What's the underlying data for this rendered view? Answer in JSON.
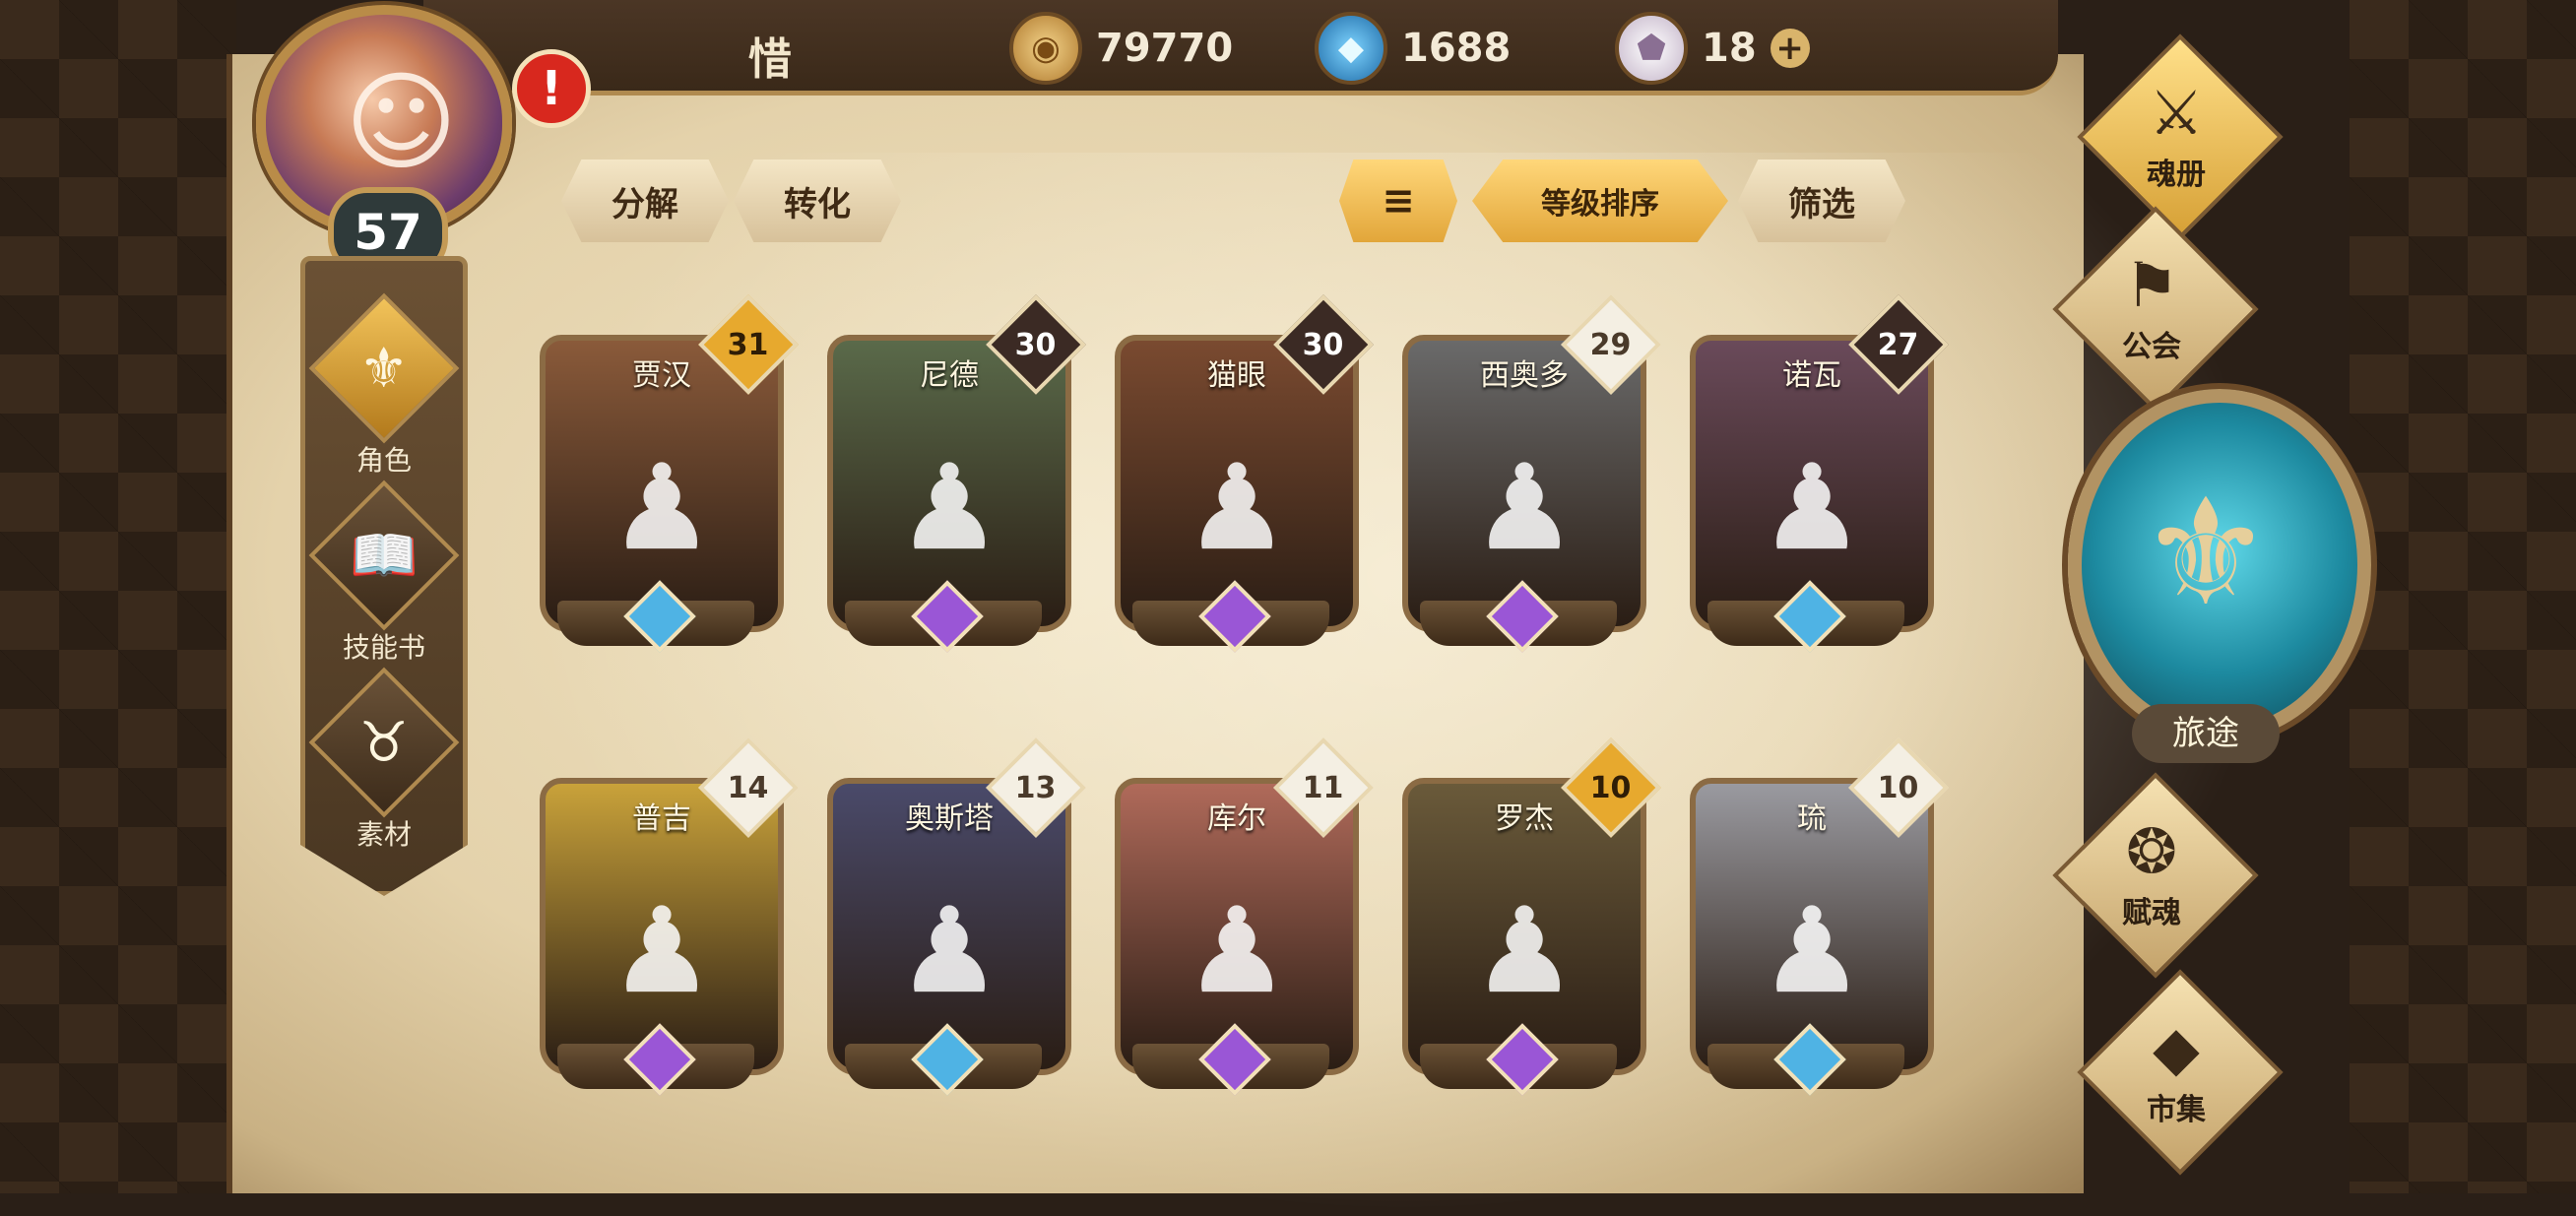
{
  "player": {
    "name": "惜",
    "level": "57",
    "alert": "!"
  },
  "currencies": {
    "coins": "79770",
    "crystals": "1688",
    "gems": "18",
    "plus": "+"
  },
  "left_nav": [
    {
      "label": "角色",
      "icon": "helmet-icon",
      "glyph": "⚜"
    },
    {
      "label": "技能书",
      "icon": "book-icon",
      "glyph": "📖"
    },
    {
      "label": "素材",
      "icon": "beast-icon",
      "glyph": "♉"
    }
  ],
  "actions": {
    "decompose": "分解",
    "convert": "转化",
    "sort_icon": "≡",
    "sort_by_level": "等级排序",
    "filter": "筛选"
  },
  "characters": [
    {
      "name": "贾汉",
      "level": "31",
      "tag": "gold",
      "rarity": "blue",
      "color": "#8a5a3a"
    },
    {
      "name": "尼德",
      "level": "30",
      "tag": "dark",
      "rarity": "purple",
      "color": "#5a6a4a"
    },
    {
      "name": "猫眼",
      "level": "30",
      "tag": "dark",
      "rarity": "purple",
      "color": "#7a4a30"
    },
    {
      "name": "西奥多",
      "level": "29",
      "tag": "light",
      "rarity": "purple",
      "color": "#6a6a6a"
    },
    {
      "name": "诺瓦",
      "level": "27",
      "tag": "dark",
      "rarity": "blue",
      "color": "#6a4a5a"
    },
    {
      "name": "普吉",
      "level": "14",
      "tag": "light",
      "rarity": "purple",
      "color": "#c9a23a"
    },
    {
      "name": "奥斯塔",
      "level": "13",
      "tag": "light",
      "rarity": "blue",
      "color": "#4a4a6a"
    },
    {
      "name": "库尔",
      "level": "11",
      "tag": "light",
      "rarity": "purple",
      "color": "#b06a5a"
    },
    {
      "name": "罗杰",
      "level": "10",
      "tag": "gold",
      "rarity": "purple",
      "color": "#6a5a3a"
    },
    {
      "name": "琉",
      "level": "10",
      "tag": "light",
      "rarity": "blue",
      "color": "#9a9aa0"
    }
  ],
  "right_menu": [
    {
      "label": "魂册",
      "icon": "soul-book-icon",
      "glyph": "⚔"
    },
    {
      "label": "公会",
      "icon": "guild-icon",
      "glyph": "⚑"
    },
    {
      "label": "赋魂",
      "icon": "flame-icon",
      "glyph": "❂"
    },
    {
      "label": "市集",
      "icon": "market-icon",
      "glyph": "◆"
    }
  ],
  "journey": {
    "label": "旅途",
    "glyph": "⚜"
  }
}
